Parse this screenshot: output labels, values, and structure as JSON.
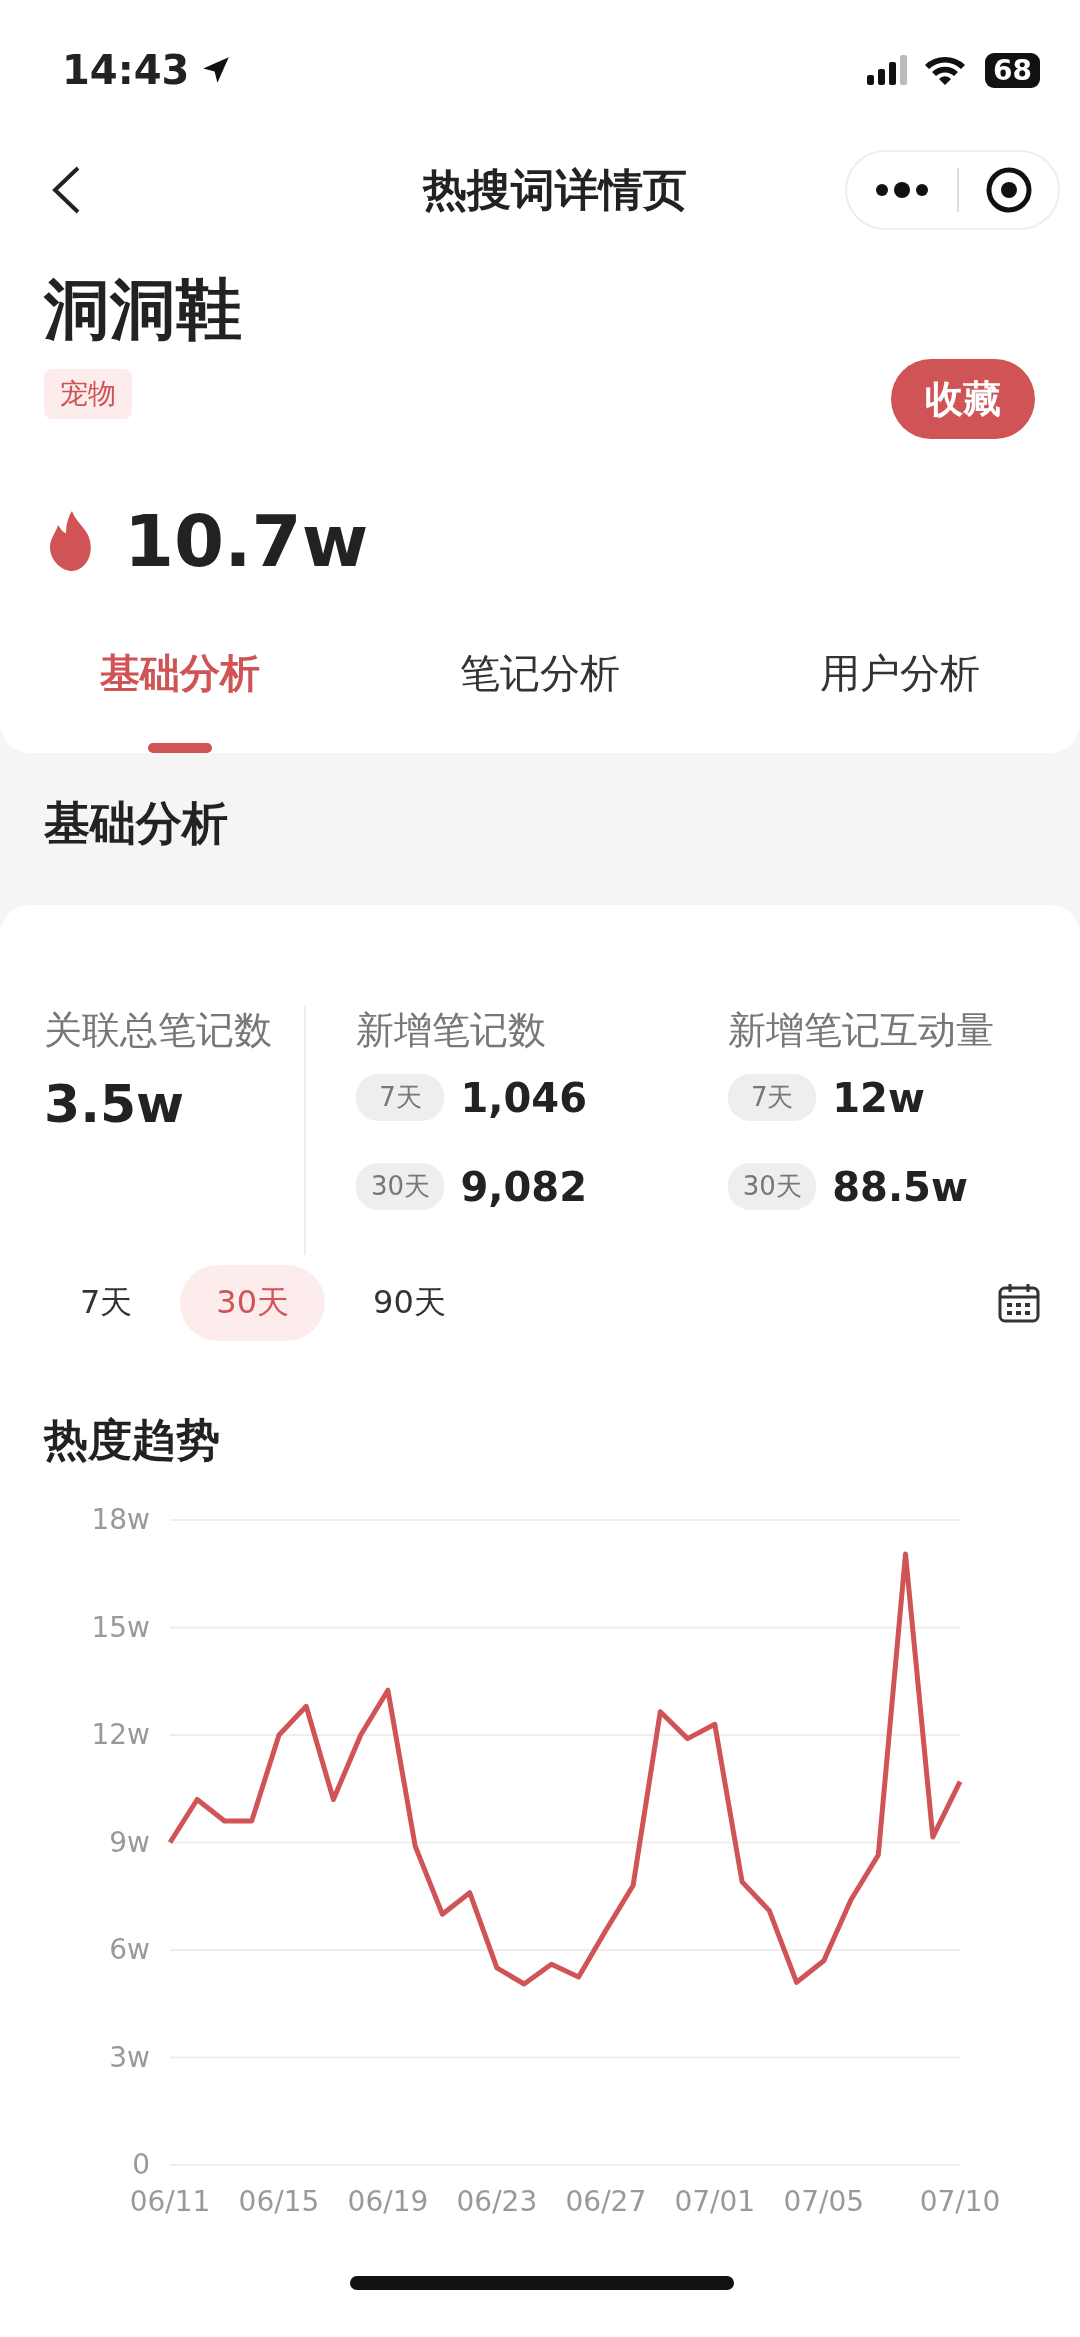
{
  "status_bar": {
    "time": "14:43",
    "battery": "68"
  },
  "nav": {
    "title": "热搜词详情页"
  },
  "keyword": {
    "title": "洞洞鞋",
    "tag": "宠物",
    "favorite_button": "收藏",
    "heat": "10.7w"
  },
  "tabs": [
    {
      "label": "基础分析",
      "selected": true
    },
    {
      "label": "笔记分析",
      "selected": false
    },
    {
      "label": "用户分析",
      "selected": false
    }
  ],
  "section_title": "基础分析",
  "stats": [
    {
      "kind": "single",
      "label": "关联总笔记数",
      "value": "3.5w"
    },
    {
      "kind": "periods",
      "label": "新增笔记数",
      "rows": [
        {
          "period": "7天",
          "value": "1,046"
        },
        {
          "period": "30天",
          "value": "9,082"
        }
      ]
    },
    {
      "kind": "periods",
      "label": "新增笔记互动量",
      "rows": [
        {
          "period": "7天",
          "value": "12w"
        },
        {
          "period": "30天",
          "value": "88.5w"
        }
      ]
    }
  ],
  "ranges": [
    {
      "label": "7天",
      "selected": false
    },
    {
      "label": "30天",
      "selected": true
    },
    {
      "label": "90天",
      "selected": false
    }
  ],
  "trend": {
    "title": "热度趋势",
    "chart_data": {
      "type": "line",
      "grid": true,
      "categories": [
        "06/11",
        null,
        null,
        null,
        "06/15",
        null,
        null,
        null,
        "06/19",
        null,
        null,
        null,
        "06/23",
        null,
        null,
        null,
        "06/27",
        null,
        null,
        null,
        "07/01",
        null,
        null,
        null,
        "07/05",
        null,
        null,
        null,
        null,
        "07/10"
      ],
      "series": [
        {
          "color": "#d05455",
          "values": [
            9.0,
            10.2,
            9.6,
            9.6,
            12.0,
            12.8,
            10.2,
            12.0,
            13.25,
            8.9,
            7.0,
            7.6,
            5.5,
            5.05,
            5.6,
            5.25,
            6.55,
            7.8,
            12.65,
            11.9,
            12.3,
            7.9,
            7.1,
            5.1,
            5.7,
            7.4,
            8.65,
            17.05,
            9.15,
            10.7
          ]
        }
      ],
      "ylim": [
        0,
        18
      ],
      "yticks": [
        {
          "value": 0,
          "label": "0"
        },
        {
          "value": 3,
          "label": "3w"
        },
        {
          "value": 6,
          "label": "6w"
        },
        {
          "value": 9,
          "label": "9w"
        },
        {
          "value": 12,
          "label": "12w"
        },
        {
          "value": 15,
          "label": "15w"
        },
        {
          "value": 18,
          "label": "18w"
        }
      ]
    }
  }
}
